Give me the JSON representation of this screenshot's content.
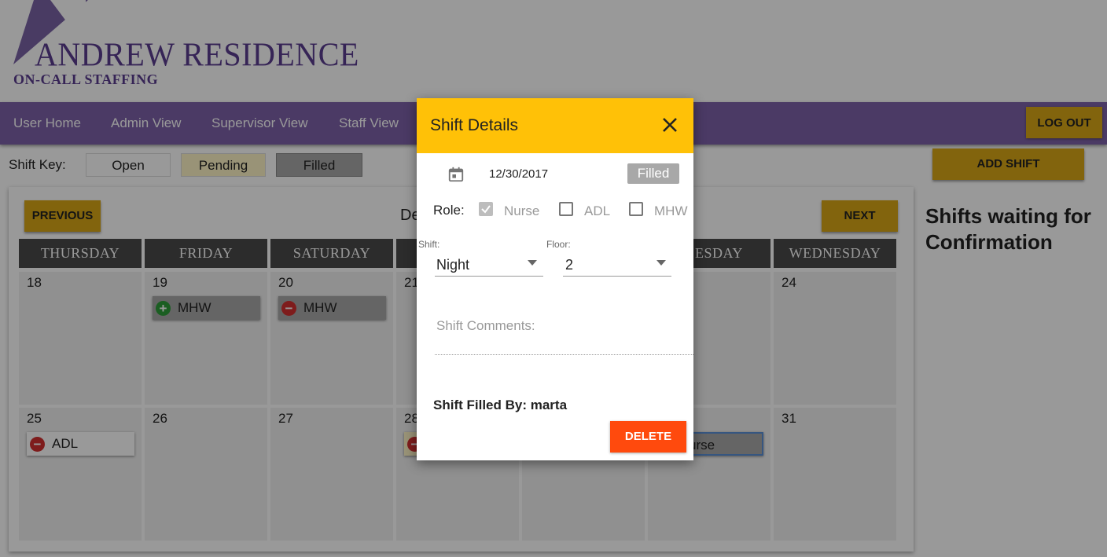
{
  "brand": {
    "title": "ANDREW RESIDENCE",
    "subtitle": "ON-CALL STAFFING"
  },
  "nav": {
    "items": [
      "User Home",
      "Admin View",
      "Supervisor View",
      "Staff View"
    ],
    "logout_label": "LOG OUT"
  },
  "shift_key": {
    "label": "Shift Key:",
    "items": [
      {
        "label": "Open",
        "color": "#ffffff"
      },
      {
        "label": "Pending",
        "color": "#fff6c7"
      },
      {
        "label": "Filled",
        "color": "#a8a8a8"
      }
    ]
  },
  "add_shift_label": "ADD SHIFT",
  "calendar": {
    "month_title": "De",
    "previous_label": "PREVIOUS",
    "next_label": "NEXT",
    "day_headers": [
      "THURSDAY",
      "FRIDAY",
      "SATURDAY",
      "",
      "",
      "ESDAY",
      "WEDNESDAY"
    ],
    "week1": [
      {
        "day": "18",
        "shift": null
      },
      {
        "day": "19",
        "shift": {
          "label": "MHW",
          "status": "filled",
          "icon": "plus"
        }
      },
      {
        "day": "20",
        "shift": {
          "label": "MHW",
          "status": "filled",
          "icon": "minus"
        }
      },
      {
        "day": "21",
        "shift": null
      },
      {
        "day": "",
        "shift": null
      },
      {
        "day": "",
        "shift": null
      },
      {
        "day": "24",
        "shift": null
      }
    ],
    "week2": [
      {
        "day": "25",
        "shift": {
          "label": "ADL",
          "status": "open",
          "icon": "minus"
        }
      },
      {
        "day": "26",
        "shift": null
      },
      {
        "day": "27",
        "shift": null
      },
      {
        "day": "28",
        "shift": null
      },
      {
        "day": "",
        "shift": null
      },
      {
        "day": "",
        "shift": {
          "label": "urse",
          "status": "filled",
          "icon": "none"
        }
      },
      {
        "day": "31",
        "shift": null
      }
    ]
  },
  "sidebar": {
    "title": "Shifts waiting for Confirmation"
  },
  "dialog": {
    "title": "Shift Details",
    "date": "12/30/2017",
    "status_badge": "Filled",
    "role_label": "Role:",
    "roles": [
      {
        "label": "Nurse",
        "checked": true
      },
      {
        "label": "ADL",
        "checked": false
      },
      {
        "label": "MHW",
        "checked": false
      }
    ],
    "shift_label": "Shift:",
    "shift_value": "Night",
    "floor_label": "Floor:",
    "floor_value": "2",
    "comments_placeholder": "Shift Comments:",
    "filled_by": "Shift Filled By: marta",
    "delete_label": "DELETE"
  },
  "colors": {
    "brand_purple": "#7d62a8",
    "accent_gold": "#d9a716",
    "dialog_header": "#ffc107",
    "delete_red": "#ff4a0d"
  }
}
